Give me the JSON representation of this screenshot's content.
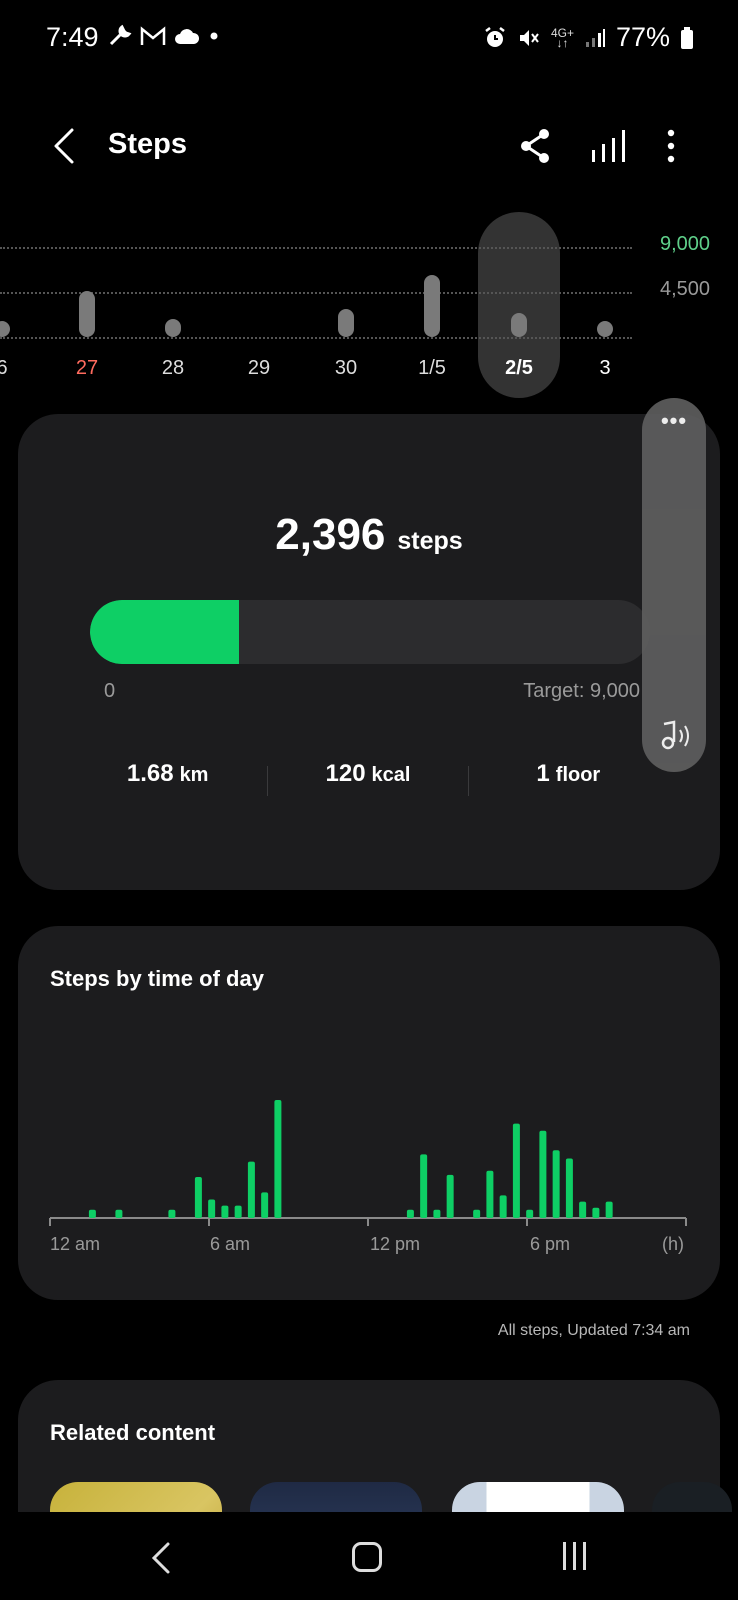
{
  "status_bar": {
    "time": "7:49",
    "network": "4G+",
    "battery": "77%"
  },
  "header": {
    "title": "Steps"
  },
  "week_chart": {
    "axis_labels": [
      "9,000",
      "4,500"
    ],
    "axis_max": 9000,
    "dates": [
      {
        "label": "6",
        "steps": 200,
        "color": "#dddddd"
      },
      {
        "label": "27",
        "steps": 4600,
        "color": "#ff6b5e"
      },
      {
        "label": "28",
        "steps": 1800,
        "color": "#dddddd"
      },
      {
        "label": "29",
        "steps": 0,
        "color": "#dddddd"
      },
      {
        "label": "30",
        "steps": 2800,
        "color": "#dddddd"
      },
      {
        "label": "1/5",
        "steps": 6200,
        "color": "#dddddd"
      },
      {
        "label": "2/5",
        "steps": 2396,
        "color": "#ffffff",
        "selected": true
      },
      {
        "label": "3",
        "steps": 400,
        "color": "#ffffff"
      }
    ]
  },
  "steps_card": {
    "steps_value": "2,396",
    "steps_unit": "steps",
    "progress_fraction": 0.266,
    "progress_start": "0",
    "target_label": "Target: 9,000",
    "summary": [
      {
        "value": "1.68",
        "unit": "km"
      },
      {
        "value": "120",
        "unit": "kcal"
      },
      {
        "value": "1",
        "unit": "floor"
      }
    ]
  },
  "side_panel": {
    "dots": "•••"
  },
  "time_of_day": {
    "title": "Steps by time of day",
    "labels": [
      "12 am",
      "6 am",
      "12 pm",
      "6 pm",
      "(h)"
    ]
  },
  "chart_data": {
    "type": "bar",
    "title": "Steps by time of day",
    "xlabel": "(h)",
    "x_ticks": [
      "12 am",
      "6 am",
      "12 pm",
      "6 pm"
    ],
    "x_range_hours": [
      0,
      24
    ],
    "bar_color": "#0ecf65",
    "hours": [
      1.6,
      2.6,
      4.6,
      5.6,
      6.1,
      6.6,
      7.1,
      7.6,
      8.1,
      8.6,
      13.6,
      14.1,
      14.6,
      15.1,
      16.1,
      16.6,
      17.1,
      17.6,
      18.1,
      18.6,
      19.1,
      19.6,
      20.1,
      20.6,
      21.1,
      21.6,
      22.1
    ],
    "values": [
      8,
      8,
      8,
      40,
      18,
      12,
      12,
      55,
      25,
      115,
      8,
      62,
      8,
      42,
      8,
      46,
      22,
      92,
      8,
      85,
      66,
      58,
      16,
      10,
      16,
      0,
      0
    ]
  },
  "updated_note": "All steps, Updated 7:34 am",
  "related": {
    "title": "Related content"
  }
}
